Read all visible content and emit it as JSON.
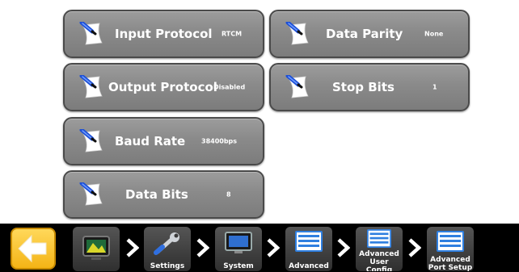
{
  "settings": {
    "input_protocol": {
      "label": "Input Protocol",
      "value": "RTCM"
    },
    "data_parity": {
      "label": "Data Parity",
      "value": "None"
    },
    "output_protocol": {
      "label": "Output Protocol",
      "value": "Disabled"
    },
    "stop_bits": {
      "label": "Stop Bits",
      "value": "1"
    },
    "baud_rate": {
      "label": "Baud Rate",
      "value": "38400bps"
    },
    "data_bits": {
      "label": "Data Bits",
      "value": "8"
    }
  },
  "breadcrumb": {
    "settings": "Settings",
    "system": "System",
    "advanced": "Advanced",
    "advanced_user_config": "Advanced User Config",
    "advanced_port_setup": "Advanced Port Setup"
  },
  "colors": {
    "tile": "#8a8a8a",
    "bar": "#000000",
    "home": "#f4b416",
    "list_icon": "#2f7fe0"
  },
  "icons": {
    "tile": "edit-pencil-icon",
    "home": "back-arrow-icon",
    "display": "display-icon",
    "settings": "wrench-icon",
    "system": "monitor-icon",
    "list": "list-icon",
    "separator": "chevron-right-icon"
  }
}
